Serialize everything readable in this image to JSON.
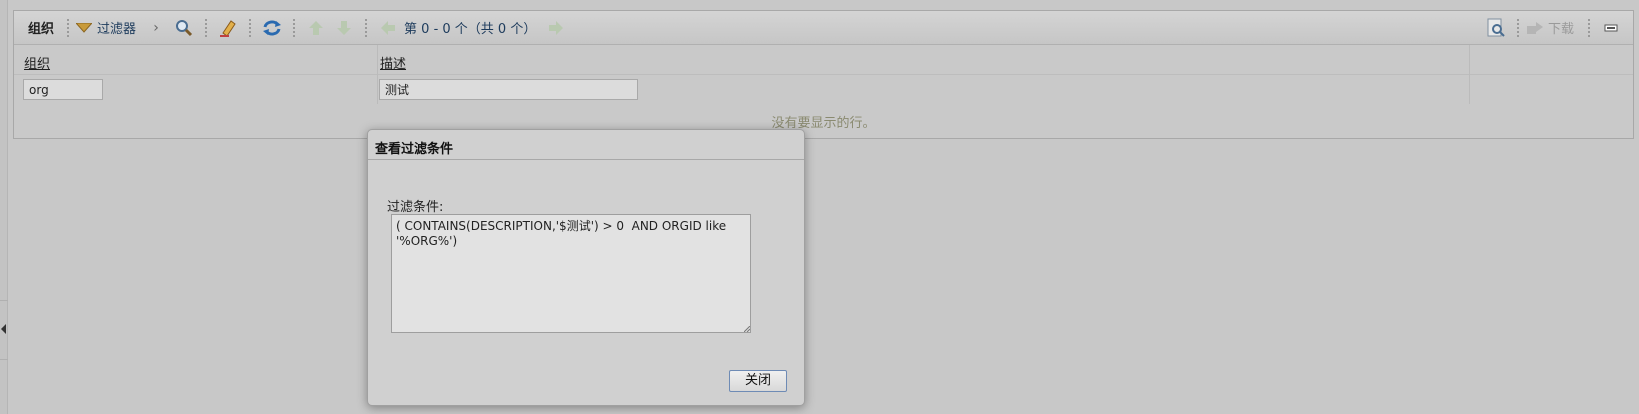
{
  "grid": {
    "title": "组织",
    "filter_label": "过滤器",
    "paging_text": "第 0 - 0 个（共 0 个）",
    "download_label": "下载",
    "columns": [
      "组织",
      "描述"
    ],
    "filter_values": {
      "org": "org",
      "description": "测试"
    },
    "empty_message": "没有要显示的行。"
  },
  "dialog": {
    "title": "查看过滤条件",
    "label": "过滤条件:",
    "condition_text": "( CONTAINS(DESCRIPTION,'$测试') > 0  AND ORGID like '%ORG%')",
    "close_label": "关闭"
  },
  "icons": {
    "filter": "filter-icon",
    "next": "chevron-right-icon",
    "search": "magnifier-icon",
    "clear": "eraser-icon",
    "refresh": "refresh-icon",
    "first": "first-page-icon",
    "prev": "prev-page-icon",
    "next_page": "next-page-icon",
    "last": "last-page-icon",
    "query": "query-icon",
    "download": "download-icon",
    "collapse": "minimize-icon",
    "left_arrow": "left-arrow-icon"
  },
  "colors": {
    "link": "#1d3b5c",
    "empty_text": "#8a8a70",
    "button_border": "#6e8bb5"
  }
}
